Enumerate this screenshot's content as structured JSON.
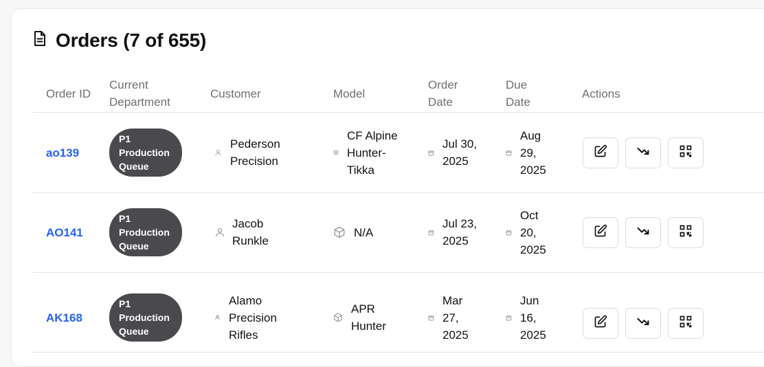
{
  "page": {
    "title": "Orders (7 of 655)"
  },
  "columns": {
    "order_id": "Order ID",
    "department": "Current Department",
    "customer": "Customer",
    "model": "Model",
    "order_date": "Order Date",
    "due_date": "Due Date",
    "actions": "Actions"
  },
  "rows": [
    {
      "order_id": "ao139",
      "department": "P1 Production Queue",
      "customer": "Pederson Precision",
      "model": "CF Alpine Hunter-Tikka",
      "order_date": "Jul 30, 2025",
      "due_date": "Aug 29, 2025"
    },
    {
      "order_id": "AO141",
      "department": "P1 Production Queue",
      "customer": "Jacob Runkle",
      "model": "N/A",
      "order_date": "Jul 23, 2025",
      "due_date": "Oct 20, 2025"
    },
    {
      "order_id": "AK168",
      "department": "P1 Production Queue",
      "customer": "Alamo Precision Rifles",
      "model": "APR Hunter",
      "order_date": "Mar 27, 2025",
      "due_date": "Jun 16, 2025"
    }
  ],
  "icons": {
    "title": "document-icon",
    "customer": "user-icon",
    "model": "box-icon",
    "date": "calendar-icon",
    "actions": [
      "edit-icon",
      "trend-down-icon",
      "qr-code-icon"
    ]
  },
  "colors": {
    "link": "#2563eb",
    "badge_bg": "#4a4a4e",
    "header_text": "#6e6e73"
  }
}
